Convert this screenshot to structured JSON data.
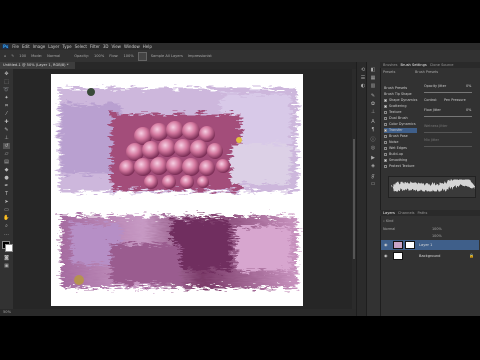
{
  "menu": {
    "logo": "Ps",
    "items": [
      "File",
      "Edit",
      "Image",
      "Layer",
      "Type",
      "Select",
      "Filter",
      "3D",
      "View",
      "Window",
      "Help"
    ]
  },
  "options": {
    "brush_size": "100",
    "mode_label": "Mode:",
    "mode_value": "Normal",
    "opacity_label": "Opacity:",
    "opacity_value": "100%",
    "flow_label": "Flow:",
    "flow_value": "100%",
    "sample_label": "Sample All Layers",
    "impressionist_label": "Impressionist"
  },
  "document": {
    "tab_title": "Untitled-1 @ 50% (Layer 1, RGB/8) *",
    "zoom_status": "50%"
  },
  "brush_settings": {
    "tabs": [
      "Brushes",
      "Brush Settings",
      "Clone Source"
    ],
    "side_tabs": [
      "Presets",
      "Brush Presets"
    ],
    "rows": [
      {
        "label": "Brush Presets",
        "checked": false,
        "selected": false
      },
      {
        "label": "Brush Tip Shape",
        "checked": false,
        "selected": false
      },
      {
        "label": "Shape Dynamics",
        "checked": true,
        "selected": false
      },
      {
        "label": "Scattering",
        "checked": true,
        "selected": false
      },
      {
        "label": "Texture",
        "checked": false,
        "selected": false
      },
      {
        "label": "Dual Brush",
        "checked": false,
        "selected": false
      },
      {
        "label": "Color Dynamics",
        "checked": false,
        "selected": false
      },
      {
        "label": "Transfer",
        "checked": true,
        "selected": true
      },
      {
        "label": "Brush Pose",
        "checked": false,
        "selected": false
      },
      {
        "label": "Noise",
        "checked": false,
        "selected": false
      },
      {
        "label": "Wet Edges",
        "checked": false,
        "selected": false
      },
      {
        "label": "Build-up",
        "checked": false,
        "selected": false
      },
      {
        "label": "Smoothing",
        "checked": true,
        "selected": false
      },
      {
        "label": "Protect Texture",
        "checked": false,
        "selected": false
      }
    ],
    "sliders": [
      {
        "label": "Opacity Jitter",
        "value": "0%"
      },
      {
        "label": "Control:",
        "value": "Pen Pressure"
      },
      {
        "label": "Flow Jitter",
        "value": "0%"
      },
      {
        "label": "Wetness Jitter",
        "value": ""
      },
      {
        "label": "Mix Jitter",
        "value": ""
      }
    ]
  },
  "layers": {
    "tabs": [
      "Layers",
      "Channels",
      "Paths"
    ],
    "blend_mode": "Normal",
    "opacity": "100%",
    "fill": "100%",
    "items": [
      {
        "name": "Layer 1",
        "selected": true
      },
      {
        "name": "Background",
        "selected": false
      }
    ]
  },
  "colors": {
    "canvas_bg": "#262626",
    "panel_bg": "#323232",
    "selection": "#3f5f8a",
    "accent": "#31a8ff"
  }
}
